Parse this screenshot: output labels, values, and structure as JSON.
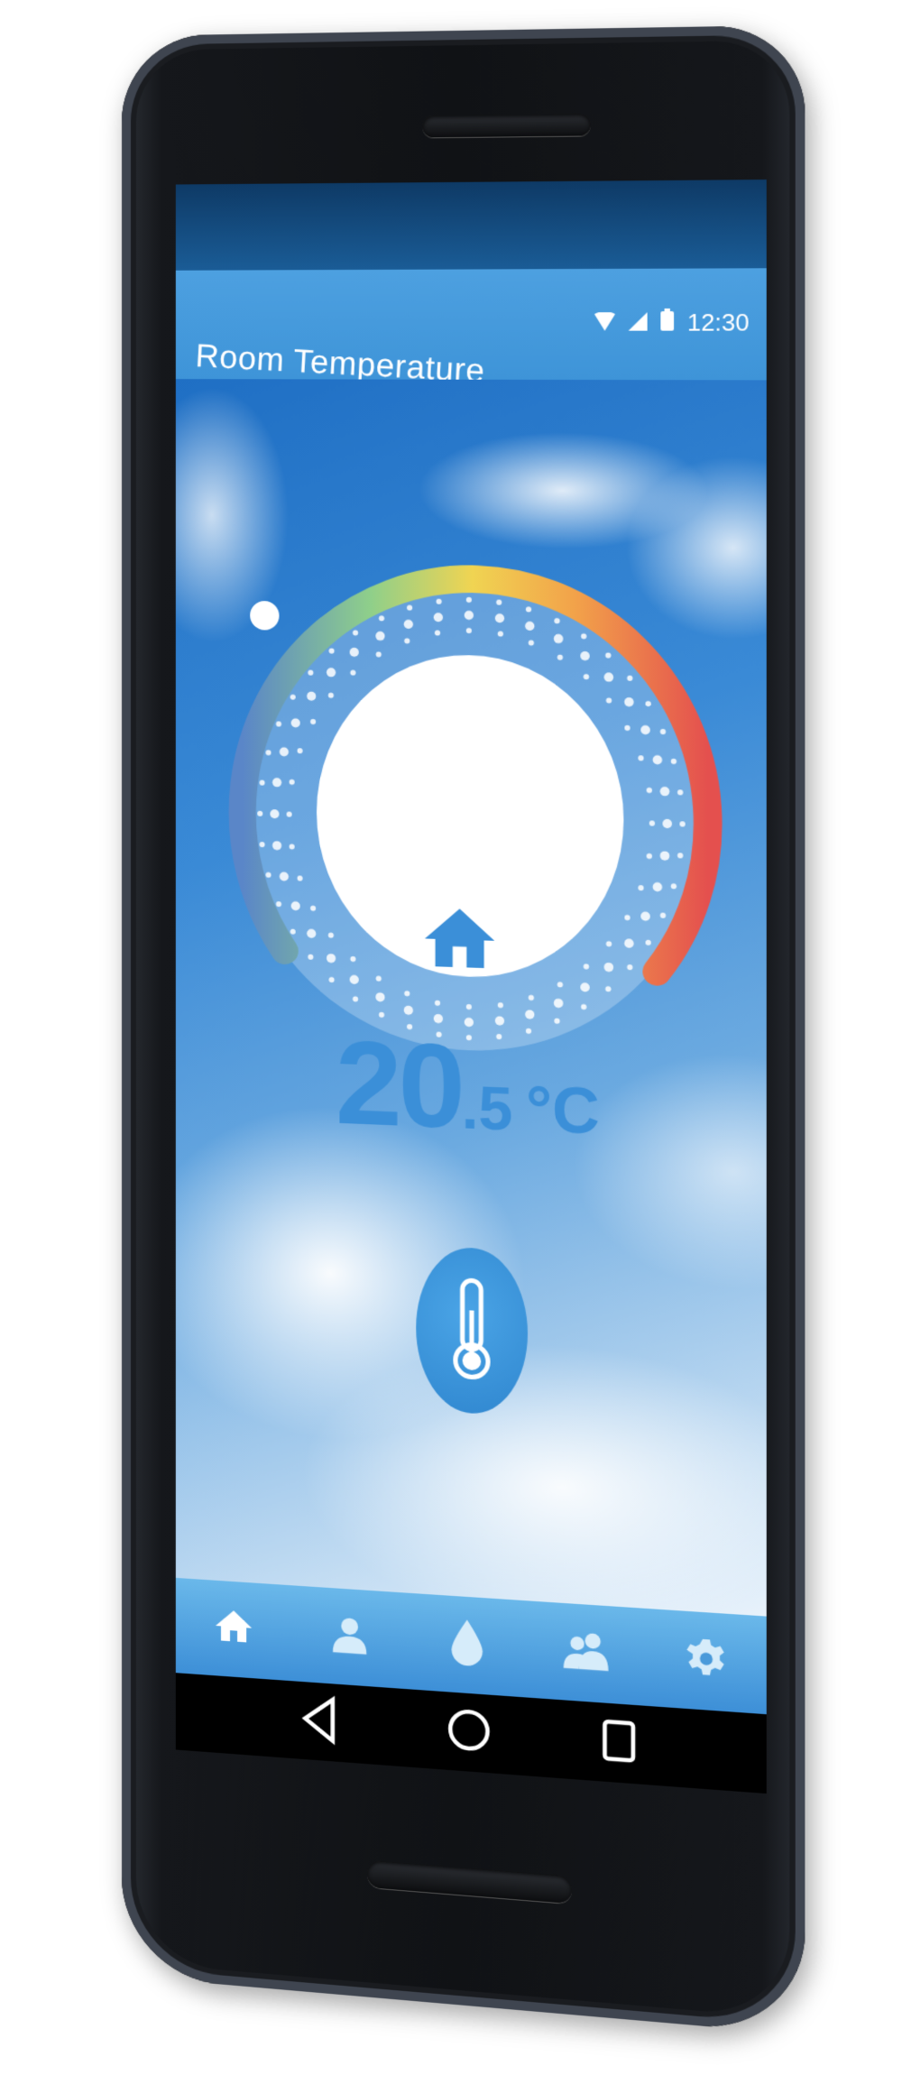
{
  "status_bar": {
    "time": "12:30"
  },
  "app_bar": {
    "title": "Room Temperature"
  },
  "thermostat": {
    "temperature_integer": "20",
    "temperature_decimal": ".5",
    "unit": "°C",
    "center_icon": "home-icon",
    "gauge_level": 0.08,
    "gauge_colors": [
      "#5a86c8",
      "#8fcf8a",
      "#f0d452",
      "#f2a24a",
      "#e4504e"
    ]
  },
  "action_button": {
    "icon": "thermometer-icon"
  },
  "bottom_nav": {
    "items": [
      {
        "icon": "home-icon",
        "active": true
      },
      {
        "icon": "person-icon",
        "active": false
      },
      {
        "icon": "water-drop-icon",
        "active": false
      },
      {
        "icon": "group-icon",
        "active": false
      },
      {
        "icon": "gear-icon",
        "active": false
      }
    ]
  },
  "system_nav": {
    "buttons": [
      "back-icon",
      "home-circle-icon",
      "recents-icon"
    ]
  },
  "colors": {
    "accent": "#3b8fd8",
    "appbar": "#4da0e0",
    "statusbar": "#0e3a66"
  }
}
